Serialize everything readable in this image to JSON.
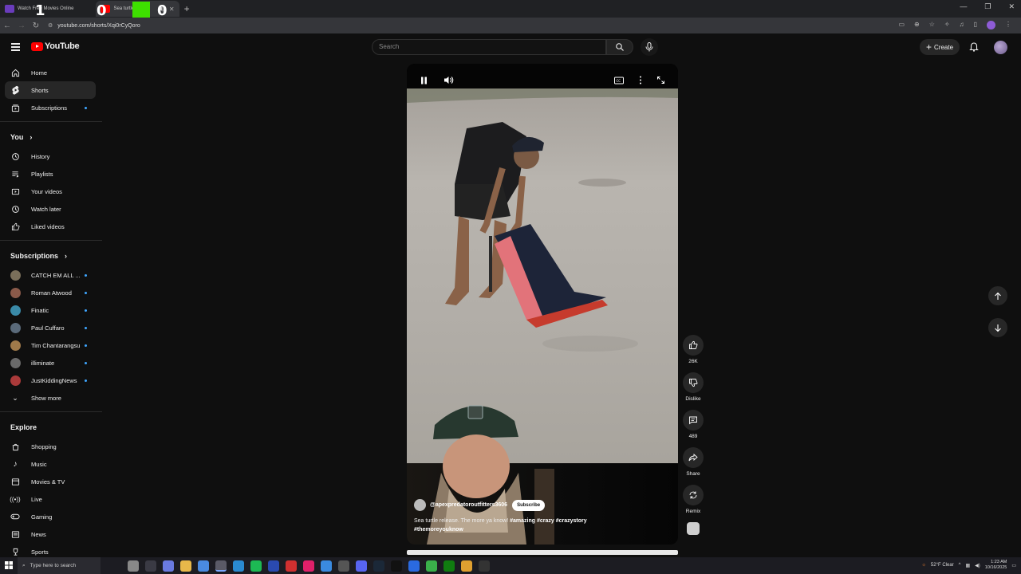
{
  "browser": {
    "tabs": [
      {
        "title": "Watch Free Movies Online",
        "active": false
      },
      {
        "title": "Sea turtle",
        "active": true
      }
    ],
    "overlay_digits": [
      "1",
      "0",
      "0"
    ],
    "url": "youtube.com/shorts/Xqi0rCyQoro"
  },
  "header": {
    "logo_text": "YouTube",
    "search_placeholder": "Search",
    "create_label": "Create"
  },
  "sidebar": {
    "main": [
      {
        "label": "Home",
        "icon": "home-icon"
      },
      {
        "label": "Shorts",
        "icon": "shorts-icon",
        "active": true
      },
      {
        "label": "Subscriptions",
        "icon": "subscriptions-icon",
        "dot": true
      }
    ],
    "you_heading": "You",
    "you": [
      {
        "label": "History",
        "icon": "history-icon"
      },
      {
        "label": "Playlists",
        "icon": "playlists-icon"
      },
      {
        "label": "Your videos",
        "icon": "your-videos-icon"
      },
      {
        "label": "Watch later",
        "icon": "watch-later-icon"
      },
      {
        "label": "Liked videos",
        "icon": "liked-videos-icon"
      }
    ],
    "subscriptions_heading": "Subscriptions",
    "subscriptions": [
      {
        "label": "CATCH EM ALL ...",
        "color": "#7a6f5a"
      },
      {
        "label": "Roman Atwood",
        "color": "#8a5a4a"
      },
      {
        "label": "Finatic",
        "color": "#3a8aa8"
      },
      {
        "label": "Paul Cuffaro",
        "color": "#5a6a7a"
      },
      {
        "label": "Tim Chantarangsu",
        "color": "#a07a4a"
      },
      {
        "label": "illiminate",
        "color": "#6a6a6a"
      },
      {
        "label": "JustKiddingNews",
        "color": "#aa3a3a"
      }
    ],
    "show_more": "Show more",
    "explore_heading": "Explore",
    "explore": [
      {
        "label": "Shopping",
        "icon": "shopping-icon"
      },
      {
        "label": "Music",
        "icon": "music-icon"
      },
      {
        "label": "Movies & TV",
        "icon": "movies-icon"
      },
      {
        "label": "Live",
        "icon": "live-icon"
      },
      {
        "label": "Gaming",
        "icon": "gaming-icon"
      },
      {
        "label": "News",
        "icon": "news-icon"
      },
      {
        "label": "Sports",
        "icon": "sports-icon"
      }
    ]
  },
  "short": {
    "channel": "@apexpredatoroutfitters3606",
    "subscribe_label": "Subscribe",
    "description_plain": "Sea turtle release. The more ya know! ",
    "hashtags_line1": "#amazing #crazy #crazystory",
    "hashtags_line2": "#themoreyouknow"
  },
  "actions": {
    "like_count": "26K",
    "dislike_label": "Dislike",
    "comment_count": "489",
    "share_label": "Share",
    "remix_label": "Remix"
  },
  "taskbar": {
    "search_placeholder": "Type here to search",
    "weather": "52°F  Clear",
    "time": "1:23 AM",
    "date": "10/16/2025"
  }
}
